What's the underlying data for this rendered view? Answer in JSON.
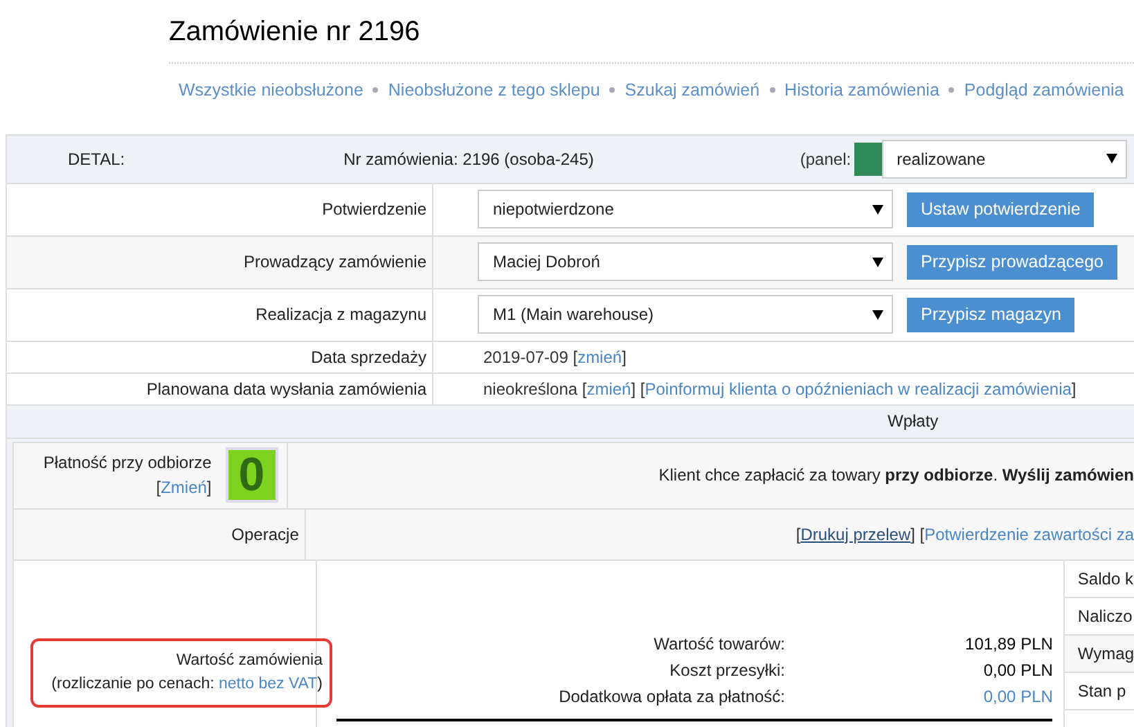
{
  "title": "Zamówienie nr 2196",
  "nav": [
    "Wszystkie nieobsłużone",
    "Nieobsłużone z tego sklepu",
    "Szukaj zamówień",
    "Historia zamówienia",
    "Podgląd zamówienia"
  ],
  "header": {
    "label": "DETAL:",
    "order": "Nr zamówienia: 2196 (osoba-245)",
    "panel": {
      "label": "(panel:",
      "color": "#2e8b57",
      "value": "realizowane"
    }
  },
  "form_rows": [
    {
      "label": "Potwierdzenie",
      "value": "niepotwierdzone",
      "button": "Ustaw potwierdzenie"
    },
    {
      "label": "Prowadzący zamówienie",
      "value": "Maciej Dobroń",
      "button": "Przypisz prowadzącego"
    },
    {
      "label": "Realizacja z magazynu",
      "value": "M1 (Main warehouse)",
      "button": "Przypisz magazyn"
    }
  ],
  "info_rows": [
    {
      "label": "Data sprzedaży",
      "parts": [
        {
          "kind": "text",
          "text": "2019-07-09 ["
        },
        {
          "kind": "link",
          "text": "zmień"
        },
        {
          "kind": "text",
          "text": "]"
        }
      ]
    },
    {
      "label": "Planowana data wysłania zamówienia",
      "parts": [
        {
          "kind": "text",
          "text": "nieokreślona ["
        },
        {
          "kind": "link",
          "text": "zmień"
        },
        {
          "kind": "text",
          "text": "] ["
        },
        {
          "kind": "link",
          "text": "Poinformuj klienta o opóźnieniach w realizacji zamówienia"
        },
        {
          "kind": "text",
          "text": "]"
        }
      ]
    }
  ],
  "payments": {
    "title": "Wpłaty",
    "cod": {
      "label": "Płatność przy odbiorze",
      "parts": [
        {
          "kind": "text",
          "text": "["
        },
        {
          "kind": "link",
          "text": "Zmień"
        },
        {
          "kind": "text",
          "text": "]"
        }
      ],
      "badge": "0",
      "message": "Klient chce zapłacić za towary **przy odbiorze**. **Wyślij zamówien**"
    },
    "operations": {
      "label": "Operacje",
      "parts": [
        {
          "kind": "text",
          "text": "["
        },
        {
          "kind": "strong-link",
          "text": "Drukuj przelew"
        },
        {
          "kind": "text",
          "text": "] ["
        },
        {
          "kind": "link",
          "text": "Potwierdzenie zawartości za"
        }
      ]
    },
    "order_value": {
      "label": "Wartość zamówienia",
      "note_prefix": "(rozliczanie po cenach: ",
      "note_link": "netto bez VAT",
      "note_suffix": ")",
      "lines": [
        {
          "label": "Wartość towarów:",
          "value": "101,89 PLN",
          "kind": "text"
        },
        {
          "label": "Koszt przesyłki:",
          "value": "0,00 PLN",
          "kind": "text"
        },
        {
          "label": "Dodatkowa opłata za płatność:",
          "value": "0,00 PLN",
          "kind": "link"
        }
      ],
      "side": [
        "Saldo k",
        "Naliczo",
        "Wymag",
        "Stan p"
      ]
    }
  }
}
